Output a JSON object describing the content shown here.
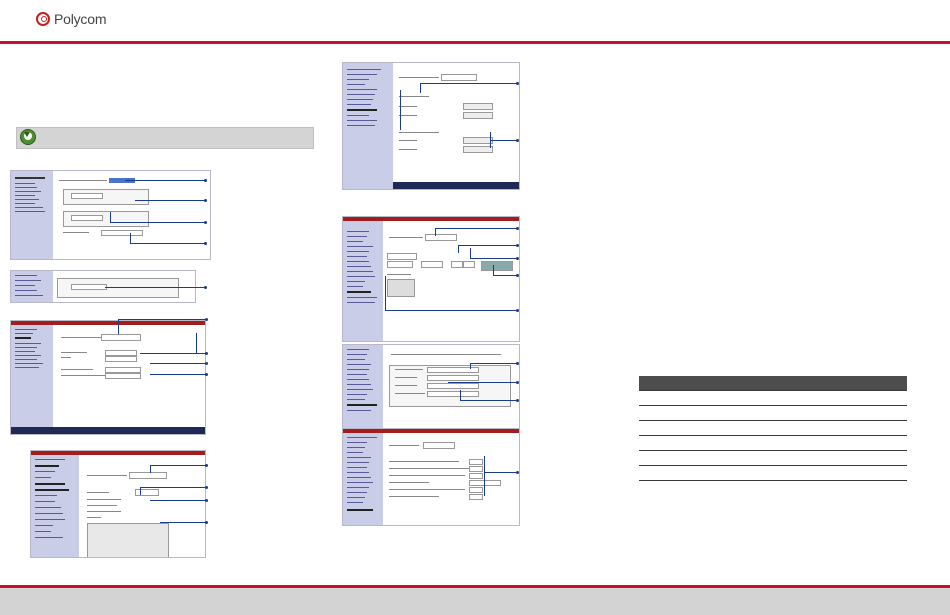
{
  "header": {
    "logo_text": "Polycom",
    "brand_color": "#c8102e"
  },
  "note": {
    "icon": "download-arrow-icon",
    "text": ""
  },
  "table": {
    "headers": [
      "",
      ""
    ],
    "rows": [
      [
        "",
        ""
      ],
      [
        "",
        ""
      ],
      [
        "",
        ""
      ],
      [
        "",
        ""
      ],
      [
        "",
        ""
      ],
      [
        "",
        ""
      ]
    ]
  },
  "footer": {
    "color": "#d3d3d3"
  }
}
